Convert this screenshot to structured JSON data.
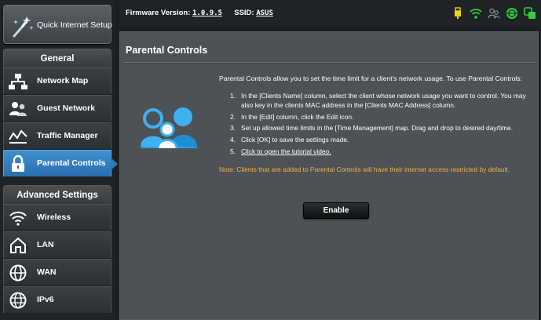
{
  "sidebar": {
    "quick_setup_label": "Quick Internet Setup",
    "general_header": "General",
    "general_items": [
      {
        "label": "Network Map",
        "icon": "network-map-icon"
      },
      {
        "label": "Guest Network",
        "icon": "guest-network-icon"
      },
      {
        "label": "Traffic Manager",
        "icon": "traffic-manager-icon"
      },
      {
        "label": "Parental Controls",
        "icon": "parental-controls-icon",
        "active": true
      }
    ],
    "advanced_header": "Advanced Settings",
    "advanced_items": [
      {
        "label": "Wireless",
        "icon": "wireless-icon"
      },
      {
        "label": "LAN",
        "icon": "lan-icon"
      },
      {
        "label": "WAN",
        "icon": "wan-icon"
      },
      {
        "label": "IPv6",
        "icon": "ipv6-icon"
      }
    ]
  },
  "topbar": {
    "firmware_label": "Firmware Version:",
    "firmware_value": "1.0.9.5",
    "ssid_label": "SSID:",
    "ssid_value": "ASUS",
    "status_icons": [
      "usb-icon",
      "wifi-icon",
      "clients-icon",
      "internet-globe-icon",
      "app-icon"
    ]
  },
  "main": {
    "title": "Parental Controls",
    "description": "Parental Controls allow you to set the time limit for a client's network usage. To use Parental Controls:",
    "steps": [
      {
        "num": "1.",
        "text": "In the [Clients Name] column, select the client whose network usage you want to control. You may also key in the clients MAC address in the [Clients MAC Address] column."
      },
      {
        "num": "2.",
        "text": "In the [Edit] column, click the Edit icon."
      },
      {
        "num": "3.",
        "text": "Set up allowed time limits in the [Time Management] map. Drag and drop to desired day/time."
      },
      {
        "num": "4.",
        "text": "Click [OK] to save the settings made."
      },
      {
        "num": "5.",
        "text": "Click to open the tutorial video.",
        "link": true
      }
    ],
    "note": "Note: Clients that are added to Parental Controls will have their internet access restricted by default.",
    "enable_button": "Enable"
  },
  "colors": {
    "accent": "#2f78b8",
    "note": "#f2b23c",
    "panel": "#4d5256",
    "icon_green": "#2fd23a",
    "icon_yellow": "#f0d20a"
  }
}
